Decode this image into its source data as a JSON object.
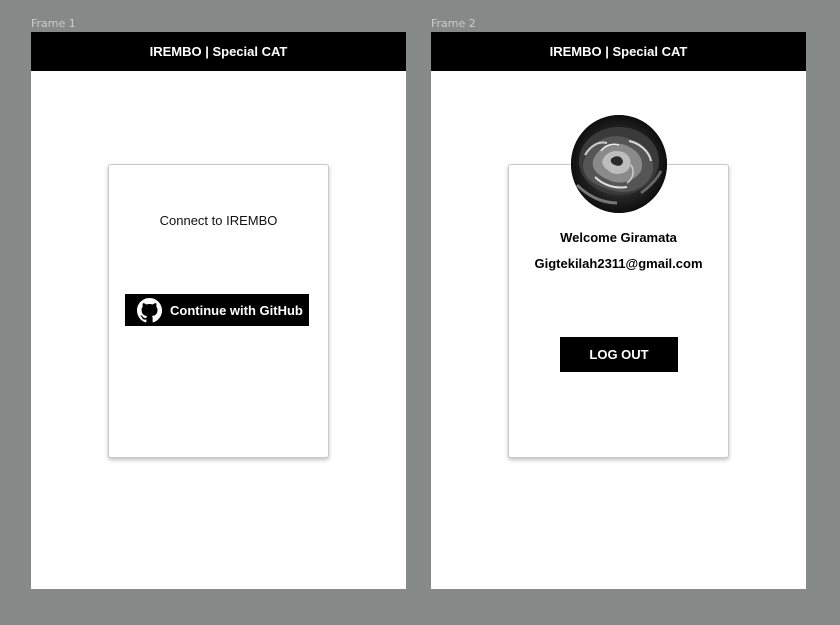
{
  "frames": [
    {
      "label": "Frame 1",
      "header_title": "IREMBO | Special CAT",
      "connect_text": "Connect to IREMBO",
      "github_button_label": "Continue with GitHub"
    },
    {
      "label": "Frame 2",
      "header_title": "IREMBO | Special CAT",
      "welcome_text": "Welcome Giramata",
      "email": "Gigtekilah2311@gmail.com",
      "logout_label": "LOG OUT"
    }
  ],
  "colors": {
    "canvas": "#858a89",
    "header": "#000000",
    "button": "#000000"
  },
  "icons": {
    "github": "github-icon",
    "avatar": "rose-avatar-image"
  }
}
